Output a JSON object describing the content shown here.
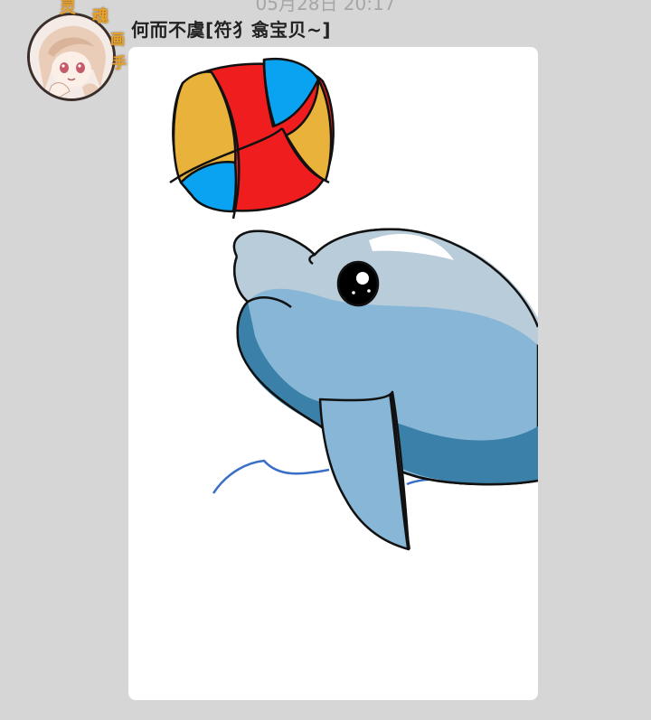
{
  "chat": {
    "timestamp": "05月28日 20:17",
    "message": {
      "sender_name": "何而不虞[符犭翕宝贝~]",
      "content_type": "image",
      "image_subject": "dolphin-with-ball-drawing",
      "avatar_badge": [
        "灵",
        "魂",
        "画",
        "手"
      ]
    }
  },
  "colors": {
    "background": "#d6d6d6",
    "bubble": "#ffffff",
    "name_text": "#222222",
    "timestamp_text": "#a6a6a6"
  }
}
